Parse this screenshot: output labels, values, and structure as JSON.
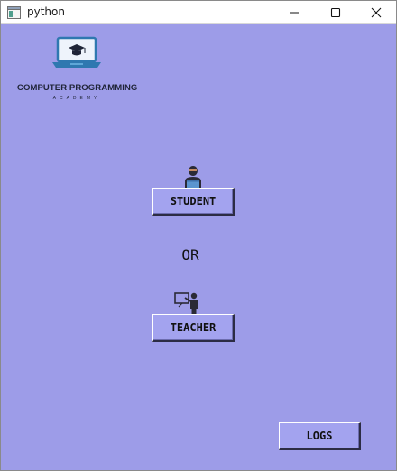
{
  "window": {
    "title": "python",
    "controls": {
      "minimize": "minimize-icon",
      "maximize": "maximize-icon",
      "close": "close-icon"
    }
  },
  "logo": {
    "title": "COMPUTER PROGRAMMING",
    "subtitle": "ACADEMY",
    "icon": "laptop-graduation-cap-icon"
  },
  "roles": {
    "student_icon": "student-icon",
    "student_label": "STUDENT",
    "separator": "OR",
    "teacher_icon": "teacher-icon",
    "teacher_label": "TEACHER"
  },
  "footer": {
    "logs_label": "LOGS"
  },
  "colors": {
    "background": "#9d9ce8",
    "button": "#a3a3ef",
    "titlebar": "#ffffff"
  }
}
